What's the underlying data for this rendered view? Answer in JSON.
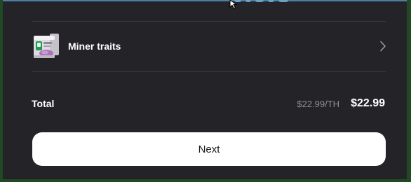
{
  "product": {
    "label": "Miner traits",
    "thumbnail_icon": "miner-device-icon",
    "chevron_icon": "chevron-right-icon"
  },
  "summary": {
    "total_label": "Total",
    "unit_price": "$22.99/TH",
    "total_amount": "$22.99"
  },
  "actions": {
    "next_label": "Next"
  },
  "colors": {
    "panel_background": "#242328",
    "window_background": "#1f4a24",
    "divider": "#3a393f",
    "primary_text": "#ffffff",
    "secondary_text": "#8f8e95",
    "button_background": "#ffffff",
    "button_text": "#1a1a1a"
  }
}
